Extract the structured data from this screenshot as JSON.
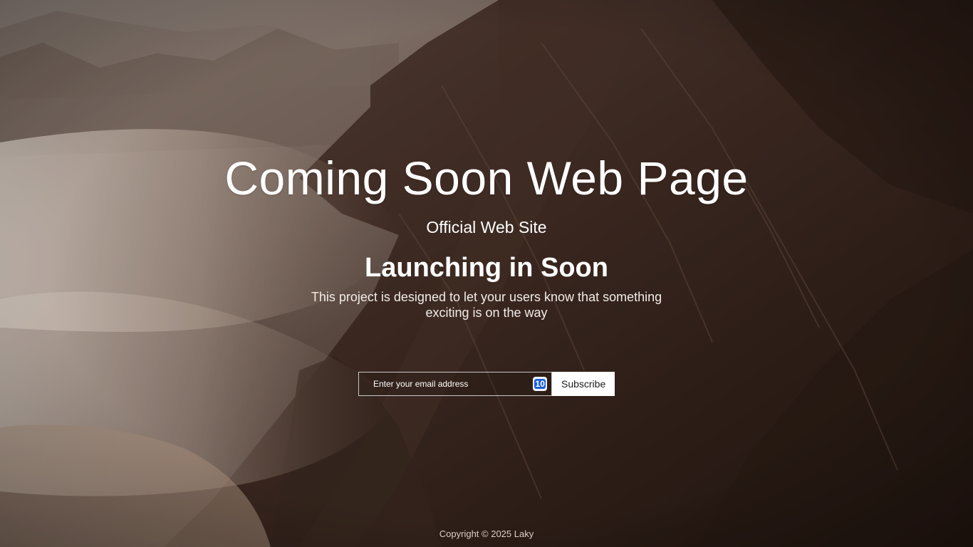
{
  "hero": {
    "title": "Coming Soon Web Page",
    "subtitle": "Official Web Site",
    "heading": "Launching in Soon",
    "description": "This project is designed to let your users know that something exciting is on the way"
  },
  "subscribe": {
    "email_placeholder": "Enter your email address",
    "email_value": "",
    "button_label": "Subscribe",
    "extension_icon": "password-manager-icon",
    "extension_icon_text": "10"
  },
  "footer": {
    "copyright": "Copyright © 2025 Laky"
  },
  "colors": {
    "text": "#ffffff",
    "button_bg": "#ffffff",
    "button_text": "#1c1c1c",
    "background_tone": "#3a2a22"
  }
}
